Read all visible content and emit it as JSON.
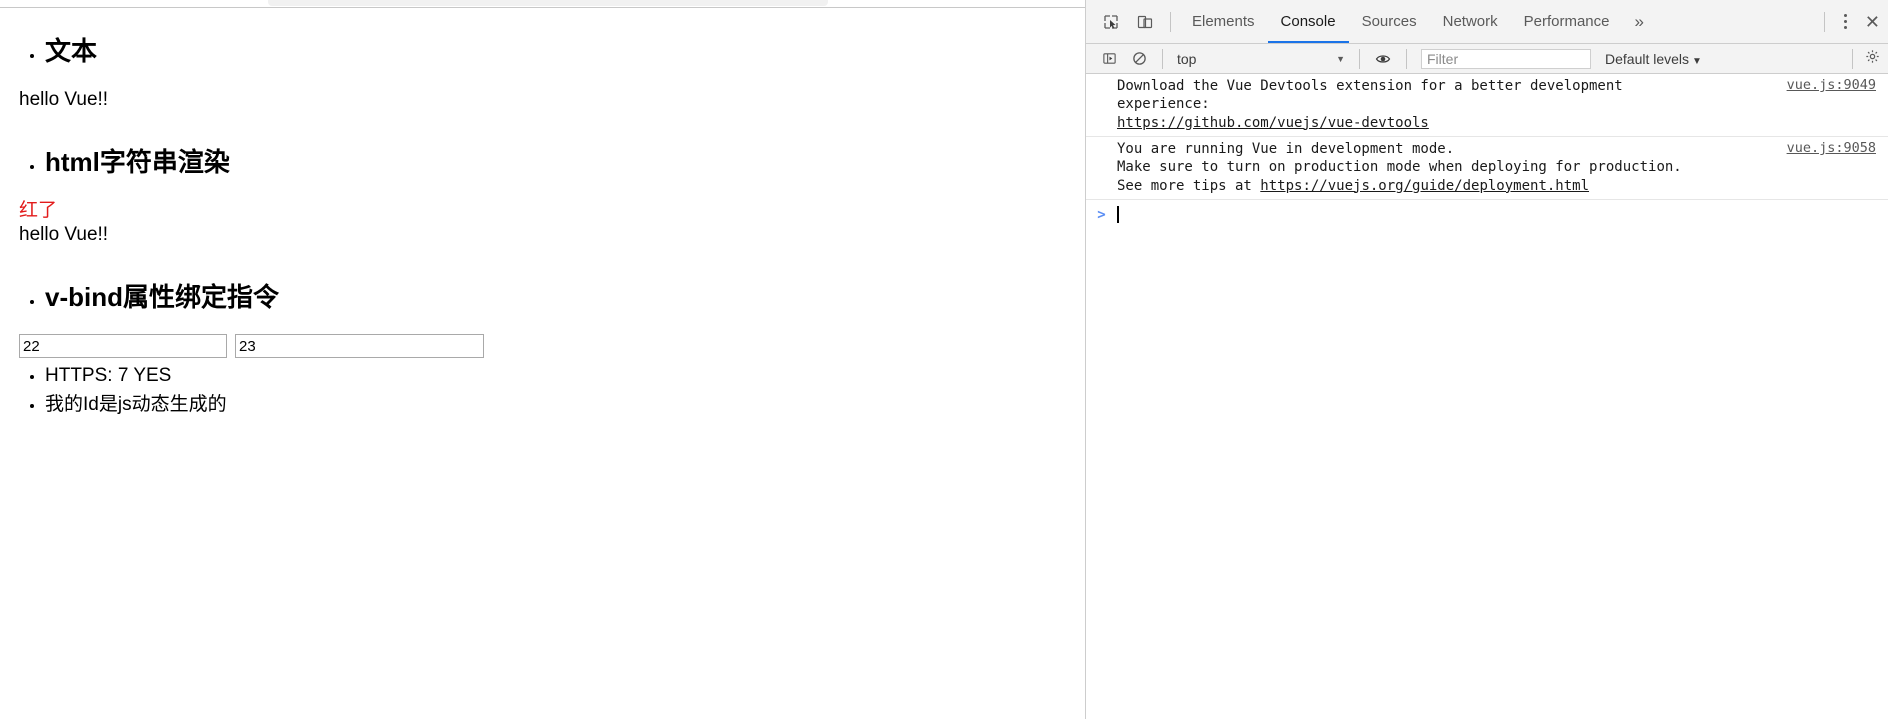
{
  "page": {
    "sections": [
      {
        "heading": "文本",
        "lines": [
          {
            "text": "hello Vue!!",
            "color": "default"
          }
        ]
      },
      {
        "heading": "html字符串渲染",
        "lines": [
          {
            "text": "红了",
            "color": "red"
          },
          {
            "text": "hello Vue!!",
            "color": "default"
          }
        ]
      },
      {
        "heading": "v-bind属性绑定指令",
        "inputs": [
          {
            "name": "input-one",
            "value": "22"
          },
          {
            "name": "input-two",
            "value": "23"
          }
        ],
        "bullets": [
          "HTTPS: 7 YES",
          "我的Id是js动态生成的"
        ]
      }
    ],
    "colors": {
      "red": "#e21b1b",
      "text": "#000000"
    }
  },
  "devtools": {
    "tabbar": {
      "inspect_icon": "inspect-element-icon",
      "device_icon": "device-toolbar-icon",
      "tabs": [
        {
          "label": "Elements",
          "active": false
        },
        {
          "label": "Console",
          "active": true
        },
        {
          "label": "Sources",
          "active": false
        },
        {
          "label": "Network",
          "active": false
        },
        {
          "label": "Performance",
          "active": false
        }
      ],
      "more_label": "»",
      "kebab_icon": "more-options-icon",
      "close_label": "✕"
    },
    "toolbar": {
      "sidebar_icon": "console-sidebar-icon",
      "clear_icon": "clear-console-icon",
      "context_value": "top",
      "context_caret": "▼",
      "eye_icon": "live-expression-icon",
      "filter_placeholder": "Filter",
      "filter_value": "",
      "levels_label": "Default levels",
      "levels_caret": "▼",
      "settings_icon": "console-settings-icon"
    },
    "console": {
      "messages": [
        {
          "lines": [
            "Download the Vue Devtools extension for a better development",
            "experience:"
          ],
          "link": "https://github.com/vuejs/vue-devtools",
          "source": "vue.js:9049"
        },
        {
          "lines": [
            "You are running Vue in development mode.",
            "Make sure to turn on production mode when deploying for production."
          ],
          "tail_prefix": "See more tips at ",
          "link": "https://vuejs.org/guide/deployment.html",
          "source": "vue.js:9058"
        }
      ],
      "prompt_caret": ">",
      "prompt_value": ""
    }
  }
}
